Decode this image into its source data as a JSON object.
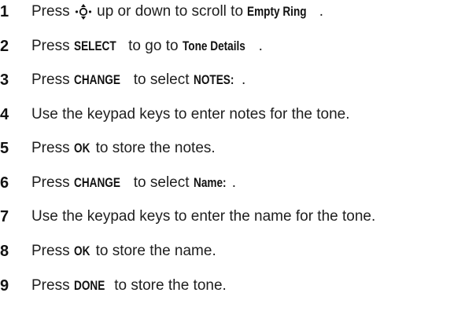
{
  "steps": [
    {
      "number": "1",
      "parts": [
        {
          "t": "Press "
        },
        {
          "icon": "nav-key-icon"
        },
        {
          "t": " up or down to scroll to "
        },
        {
          "k": "Empty Ring"
        },
        {
          "t": "."
        }
      ]
    },
    {
      "number": "2",
      "parts": [
        {
          "t": "Press "
        },
        {
          "k": "SELECT"
        },
        {
          "t": " to go to "
        },
        {
          "k": "Tone Details"
        },
        {
          "t": "."
        }
      ]
    },
    {
      "number": "3",
      "parts": [
        {
          "t": "Press "
        },
        {
          "k": "CHANGE"
        },
        {
          "t": " to select "
        },
        {
          "k": "NOTES:"
        },
        {
          "t": "."
        }
      ]
    },
    {
      "number": "4",
      "parts": [
        {
          "t": "Use the keypad keys to enter notes for the tone."
        }
      ]
    },
    {
      "number": "5",
      "parts": [
        {
          "t": "Press "
        },
        {
          "k": "OK"
        },
        {
          "t": " to store the notes."
        }
      ]
    },
    {
      "number": "6",
      "parts": [
        {
          "t": "Press "
        },
        {
          "k": "CHANGE"
        },
        {
          "t": " to select "
        },
        {
          "k": "Name:"
        },
        {
          "t": "."
        }
      ]
    },
    {
      "number": "7",
      "parts": [
        {
          "t": "Use the keypad keys to enter the name for the tone."
        }
      ]
    },
    {
      "number": "8",
      "parts": [
        {
          "t": "Press "
        },
        {
          "k": "OK"
        },
        {
          "t": " to store the name."
        }
      ]
    },
    {
      "number": "9",
      "parts": [
        {
          "t": "Press "
        },
        {
          "k": "DONE"
        },
        {
          "t": " to store the tone."
        }
      ]
    }
  ]
}
